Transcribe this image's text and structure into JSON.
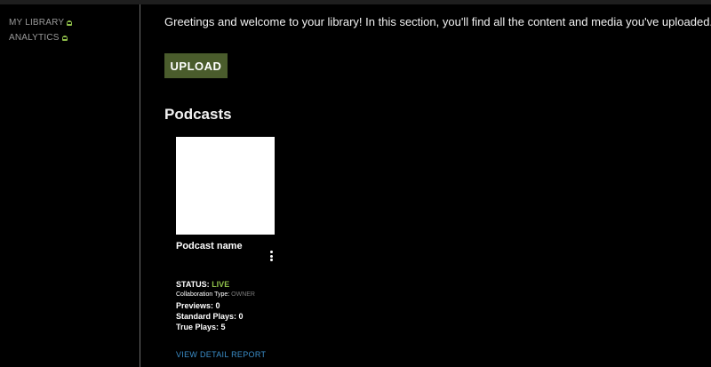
{
  "sidebar": {
    "items": [
      {
        "label": "MY LIBRARY",
        "icon": "ghost-icon"
      },
      {
        "label": "ANALYTICS",
        "icon": "ghost-icon"
      }
    ]
  },
  "main": {
    "greeting": "Greetings and welcome to your library! In this section, you'll find all the content and media you've uploaded.",
    "upload_label": "UPLOAD",
    "section_title": "Podcasts",
    "podcast": {
      "name": "Podcast name",
      "status_label": "STATUS:",
      "status_value": "LIVE",
      "collab_label": "Collaboration Type:",
      "collab_value": "OWNER",
      "previews": "Previews: 0",
      "standard_plays": "Standard Plays: 0",
      "true_plays": "True Plays: 5",
      "detail_link": "VIEW DETAIL REPORT"
    }
  },
  "colors": {
    "accent_green": "#8fc04a",
    "upload_bg": "#4a5c2c",
    "link_blue": "#3b8ec9"
  }
}
